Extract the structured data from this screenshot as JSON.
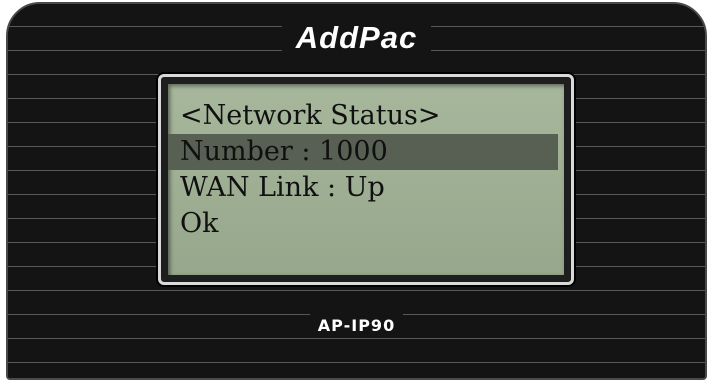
{
  "device": {
    "brand": "AddPac",
    "model": "AP-IP90"
  },
  "lcd": {
    "lines": [
      "<Network Status>",
      "Number : 1000",
      "WAN Link : Up",
      "Ok"
    ],
    "selected_line": 1
  },
  "colors": {
    "lcd_background": "#a1b196",
    "lcd_selection": "#585f53",
    "lcd_text": "#101010",
    "body": "#141414"
  }
}
